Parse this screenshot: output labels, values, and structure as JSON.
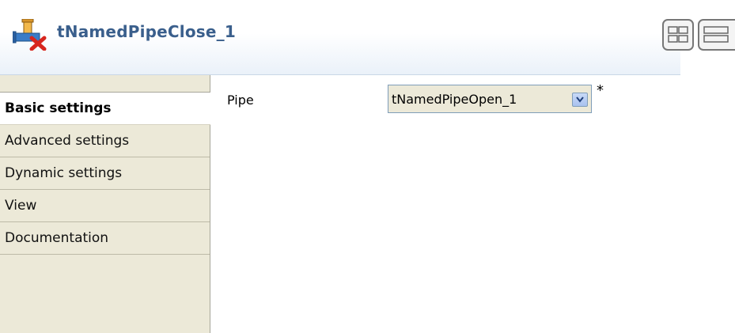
{
  "header": {
    "title": "tNamedPipeClose_1",
    "icon": "pipe-close-icon"
  },
  "toolbar": {
    "buttons": [
      {
        "icon": "grid-view-icon"
      },
      {
        "icon": "list-view-icon"
      }
    ]
  },
  "sidebar": {
    "items": [
      {
        "label": "Basic settings",
        "active": true
      },
      {
        "label": "Advanced settings",
        "active": false
      },
      {
        "label": "Dynamic settings",
        "active": false
      },
      {
        "label": "View",
        "active": false
      },
      {
        "label": "Documentation",
        "active": false
      }
    ]
  },
  "form": {
    "pipe_label": "Pipe",
    "pipe_value": "tNamedPipeOpen_1",
    "required_marker": "*"
  },
  "colors": {
    "title": "#3a5f8c",
    "sidebar_bg": "#ece9d8",
    "select_border": "#7f9db9"
  }
}
